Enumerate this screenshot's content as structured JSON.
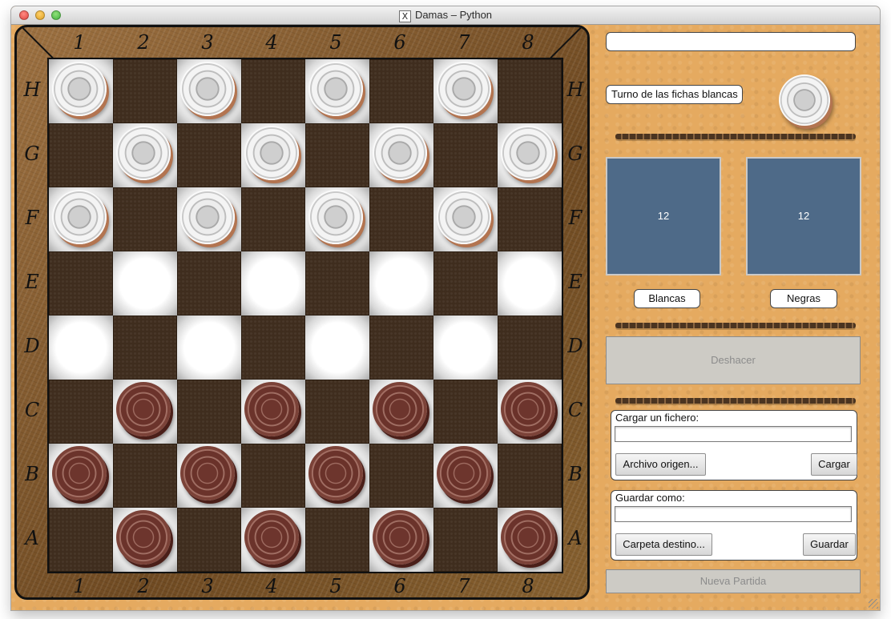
{
  "window": {
    "title": "Damas – Python"
  },
  "board": {
    "columns": [
      "1",
      "2",
      "3",
      "4",
      "5",
      "6",
      "7",
      "8"
    ],
    "rows": [
      "H",
      "G",
      "F",
      "E",
      "D",
      "C",
      "B",
      "A"
    ],
    "pieces": [
      [
        "white",
        "",
        "white",
        "",
        "white",
        "",
        "white",
        ""
      ],
      [
        "",
        "white",
        "",
        "white",
        "",
        "white",
        "",
        "white"
      ],
      [
        "white",
        "",
        "white",
        "",
        "white",
        "",
        "white",
        ""
      ],
      [
        "",
        "",
        "",
        "",
        "",
        "",
        "",
        ""
      ],
      [
        "",
        "",
        "",
        "",
        "",
        "",
        "",
        ""
      ],
      [
        "",
        "red",
        "",
        "red",
        "",
        "red",
        "",
        "red"
      ],
      [
        "red",
        "",
        "red",
        "",
        "red",
        "",
        "red",
        ""
      ],
      [
        "",
        "red",
        "",
        "red",
        "",
        "red",
        "",
        "red"
      ]
    ]
  },
  "panel": {
    "message": "",
    "turn_text": "Turno de las fichas blancas",
    "turn_piece": "white",
    "white_count": "12",
    "black_count": "12",
    "white_label": "Blancas",
    "black_label": "Negras",
    "undo_label": "Deshacer",
    "load": {
      "title": "Cargar un fichero:",
      "path": "",
      "browse_label": "Archivo origen...",
      "action_label": "Cargar"
    },
    "save": {
      "title": "Guardar como:",
      "path": "",
      "browse_label": "Carpeta destino...",
      "action_label": "Guardar"
    },
    "new_game_label": "Nueva Partida"
  },
  "colors": {
    "background": "#e5aa60",
    "dark_square": "#3f2d1e",
    "count_box": "#4e6a88"
  }
}
